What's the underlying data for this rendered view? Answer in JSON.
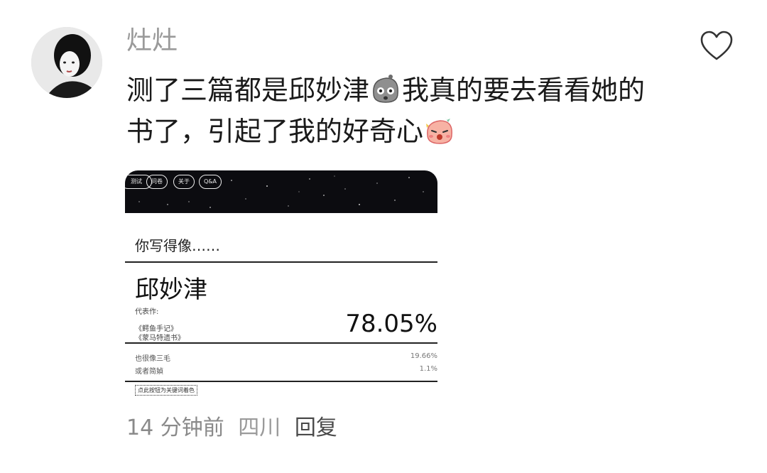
{
  "comment": {
    "username": "灶灶",
    "text_part1": "测了三篇都是邱妙津",
    "text_part2": "我真的要去看看她的书了，引起了我的好奇心",
    "time": "14 分钟前",
    "location": "四川",
    "reply_label": "回复"
  },
  "screenshot": {
    "nav": [
      "测试",
      "问卷",
      "关于",
      "Q&A"
    ],
    "question": "你写得像……",
    "author": "邱妙津",
    "works_label": "代表作:",
    "works": [
      "《鳄鱼手记》",
      "《蒙马特遗书》"
    ],
    "percent": "78.05%",
    "alternatives": [
      {
        "name": "也很像三毛",
        "value": "19.66%"
      },
      {
        "name": "或者简媜",
        "value": "1.1%"
      }
    ],
    "hint": "点此按钮为关键词着色"
  },
  "colors": {
    "username": "#9a9a9a",
    "meta_text": "#8a8a8a",
    "reply": "#4a4a4a",
    "starfield": "#0c0c10"
  },
  "icons": {
    "like": "heart-outline-icon",
    "emoji1": "grey-face-emoji",
    "emoji2": "pink-blushing-emoji"
  }
}
